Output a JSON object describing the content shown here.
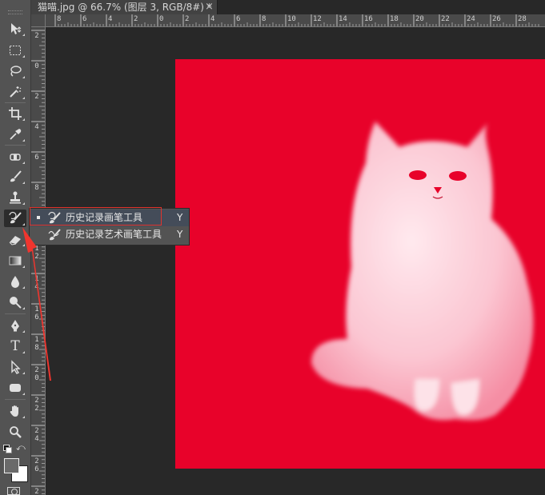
{
  "document_tab": {
    "title": "猫喵.jpg @ 66.7% (图层 3, RGB/8#) *",
    "close_glyph": "×"
  },
  "rulers": {
    "top_labels": [
      "8",
      "6",
      "4",
      "2",
      "0",
      "2",
      "4",
      "6",
      "8",
      "10",
      "12",
      "14",
      "16",
      "18",
      "20",
      "22",
      "24",
      "26",
      "28"
    ],
    "left_labels": [
      "2",
      "0",
      "2",
      "4",
      "6",
      "8",
      "1 0",
      "1 2",
      "1 4",
      "1 6",
      "1 8",
      "2 0",
      "2 2",
      "2 4",
      "2 6",
      "2 8"
    ]
  },
  "tools": [
    {
      "name": "move-tool",
      "icon": "move-icon"
    },
    {
      "name": "marquee-tool",
      "icon": "rect-marquee-icon"
    },
    {
      "name": "lasso-tool",
      "icon": "lasso-icon"
    },
    {
      "name": "magic-wand-tool",
      "icon": "magic-wand-icon"
    },
    {
      "name": "crop-tool",
      "icon": "crop-icon"
    },
    {
      "name": "eyedropper-tool",
      "icon": "eyedropper-icon"
    },
    {
      "name": "healing-brush-tool",
      "icon": "bandage-icon"
    },
    {
      "name": "brush-tool",
      "icon": "brush-icon"
    },
    {
      "name": "clone-stamp-tool",
      "icon": "stamp-icon"
    },
    {
      "name": "history-brush-tool",
      "icon": "history-brush-icon",
      "active": true
    },
    {
      "name": "eraser-tool",
      "icon": "eraser-icon"
    },
    {
      "name": "gradient-tool",
      "icon": "gradient-icon"
    },
    {
      "name": "blur-tool",
      "icon": "drop-icon"
    },
    {
      "name": "dodge-tool",
      "icon": "dodge-icon"
    },
    {
      "name": "pen-tool",
      "icon": "pen-icon"
    },
    {
      "name": "type-tool",
      "icon": "type-icon",
      "glyph": "T"
    },
    {
      "name": "path-selection-tool",
      "icon": "arrow-select-icon"
    },
    {
      "name": "shape-tool",
      "icon": "rounded-rect-icon"
    },
    {
      "name": "hand-tool",
      "icon": "hand-icon"
    },
    {
      "name": "zoom-tool",
      "icon": "zoom-icon"
    }
  ],
  "flyout": {
    "items": [
      {
        "label": "历史记录画笔工具",
        "shortcut": "Y",
        "selected": true
      },
      {
        "label": "历史记录艺术画笔工具",
        "shortcut": "Y",
        "selected": false
      }
    ]
  },
  "colors": {
    "canvas_fill": "#e8022a",
    "toolbar": "#535353",
    "annotation": "#e0332c",
    "foreground_swatch": "#6a6a6a",
    "background_swatch": "#ffffff"
  }
}
